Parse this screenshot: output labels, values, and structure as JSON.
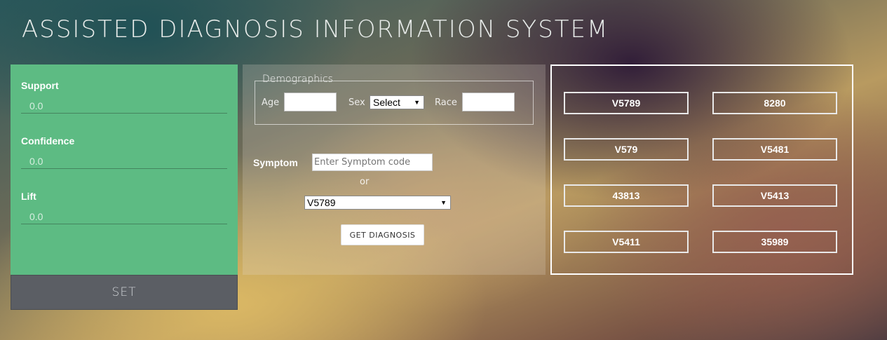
{
  "header": {
    "title": "ASSISTED DIAGNOSIS INFORMATION SYSTEM"
  },
  "params": {
    "support": {
      "label": "Support",
      "value": "0.0"
    },
    "confidence": {
      "label": "Confidence",
      "value": "0.0"
    },
    "lift": {
      "label": "Lift",
      "value": "0.0"
    },
    "set_label": "SET"
  },
  "demographics": {
    "legend": "Demographics",
    "age_label": "Age",
    "sex_label": "Sex",
    "sex_selected": "Select",
    "race_label": "Race"
  },
  "symptom": {
    "label": "Symptom",
    "placeholder": "Enter Symptom code",
    "or_text": "or",
    "selected": "V5789",
    "diagnose_label": "GET DIAGNOSIS"
  },
  "results": {
    "codes": [
      "V5789",
      "8280",
      "V579",
      "V5481",
      "43813",
      "V5413",
      "V5411",
      "35989"
    ]
  },
  "colors": {
    "panel_green": "#5dbb83",
    "set_bar": "#5b5e64"
  }
}
